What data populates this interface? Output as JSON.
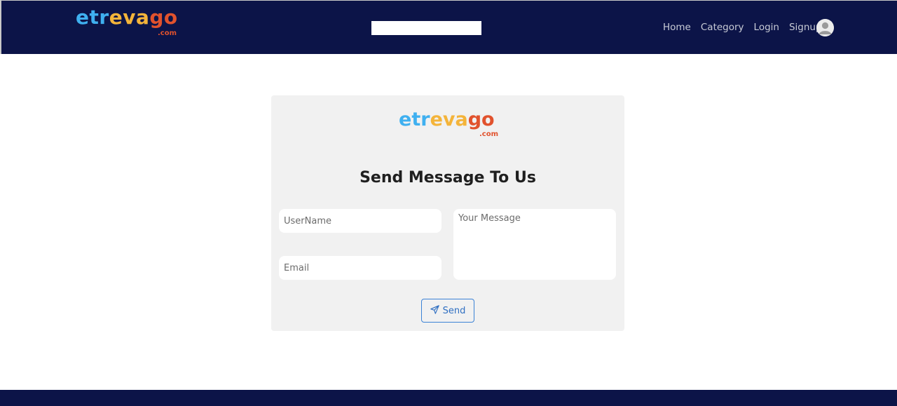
{
  "navbar": {
    "brand": {
      "letters": [
        "e",
        "t",
        "r",
        "e",
        "v",
        "a",
        "g",
        "o"
      ],
      "suffix": ".com"
    },
    "search": {
      "value": "",
      "placeholder": ""
    },
    "links": [
      "Home",
      "Category",
      "Login",
      "Signup"
    ],
    "avatar_icon": "user-avatar-icon"
  },
  "card": {
    "brand": {
      "letters": [
        "e",
        "t",
        "r",
        "e",
        "v",
        "a",
        "g",
        "o"
      ],
      "suffix": ".com"
    },
    "title": "Send Message To Us",
    "username_placeholder": "UserName",
    "email_placeholder": "Email",
    "message_placeholder": "Your Message",
    "send_label": "Send",
    "send_icon": "send-icon"
  },
  "colors": {
    "navbar_bg": "#0c1448",
    "brand_blue": "#3fb0f0",
    "brand_yellow": "#f4b43a",
    "brand_red": "#e1522d",
    "card_bg": "#f1f1f1",
    "send_border": "#3b82d6"
  }
}
